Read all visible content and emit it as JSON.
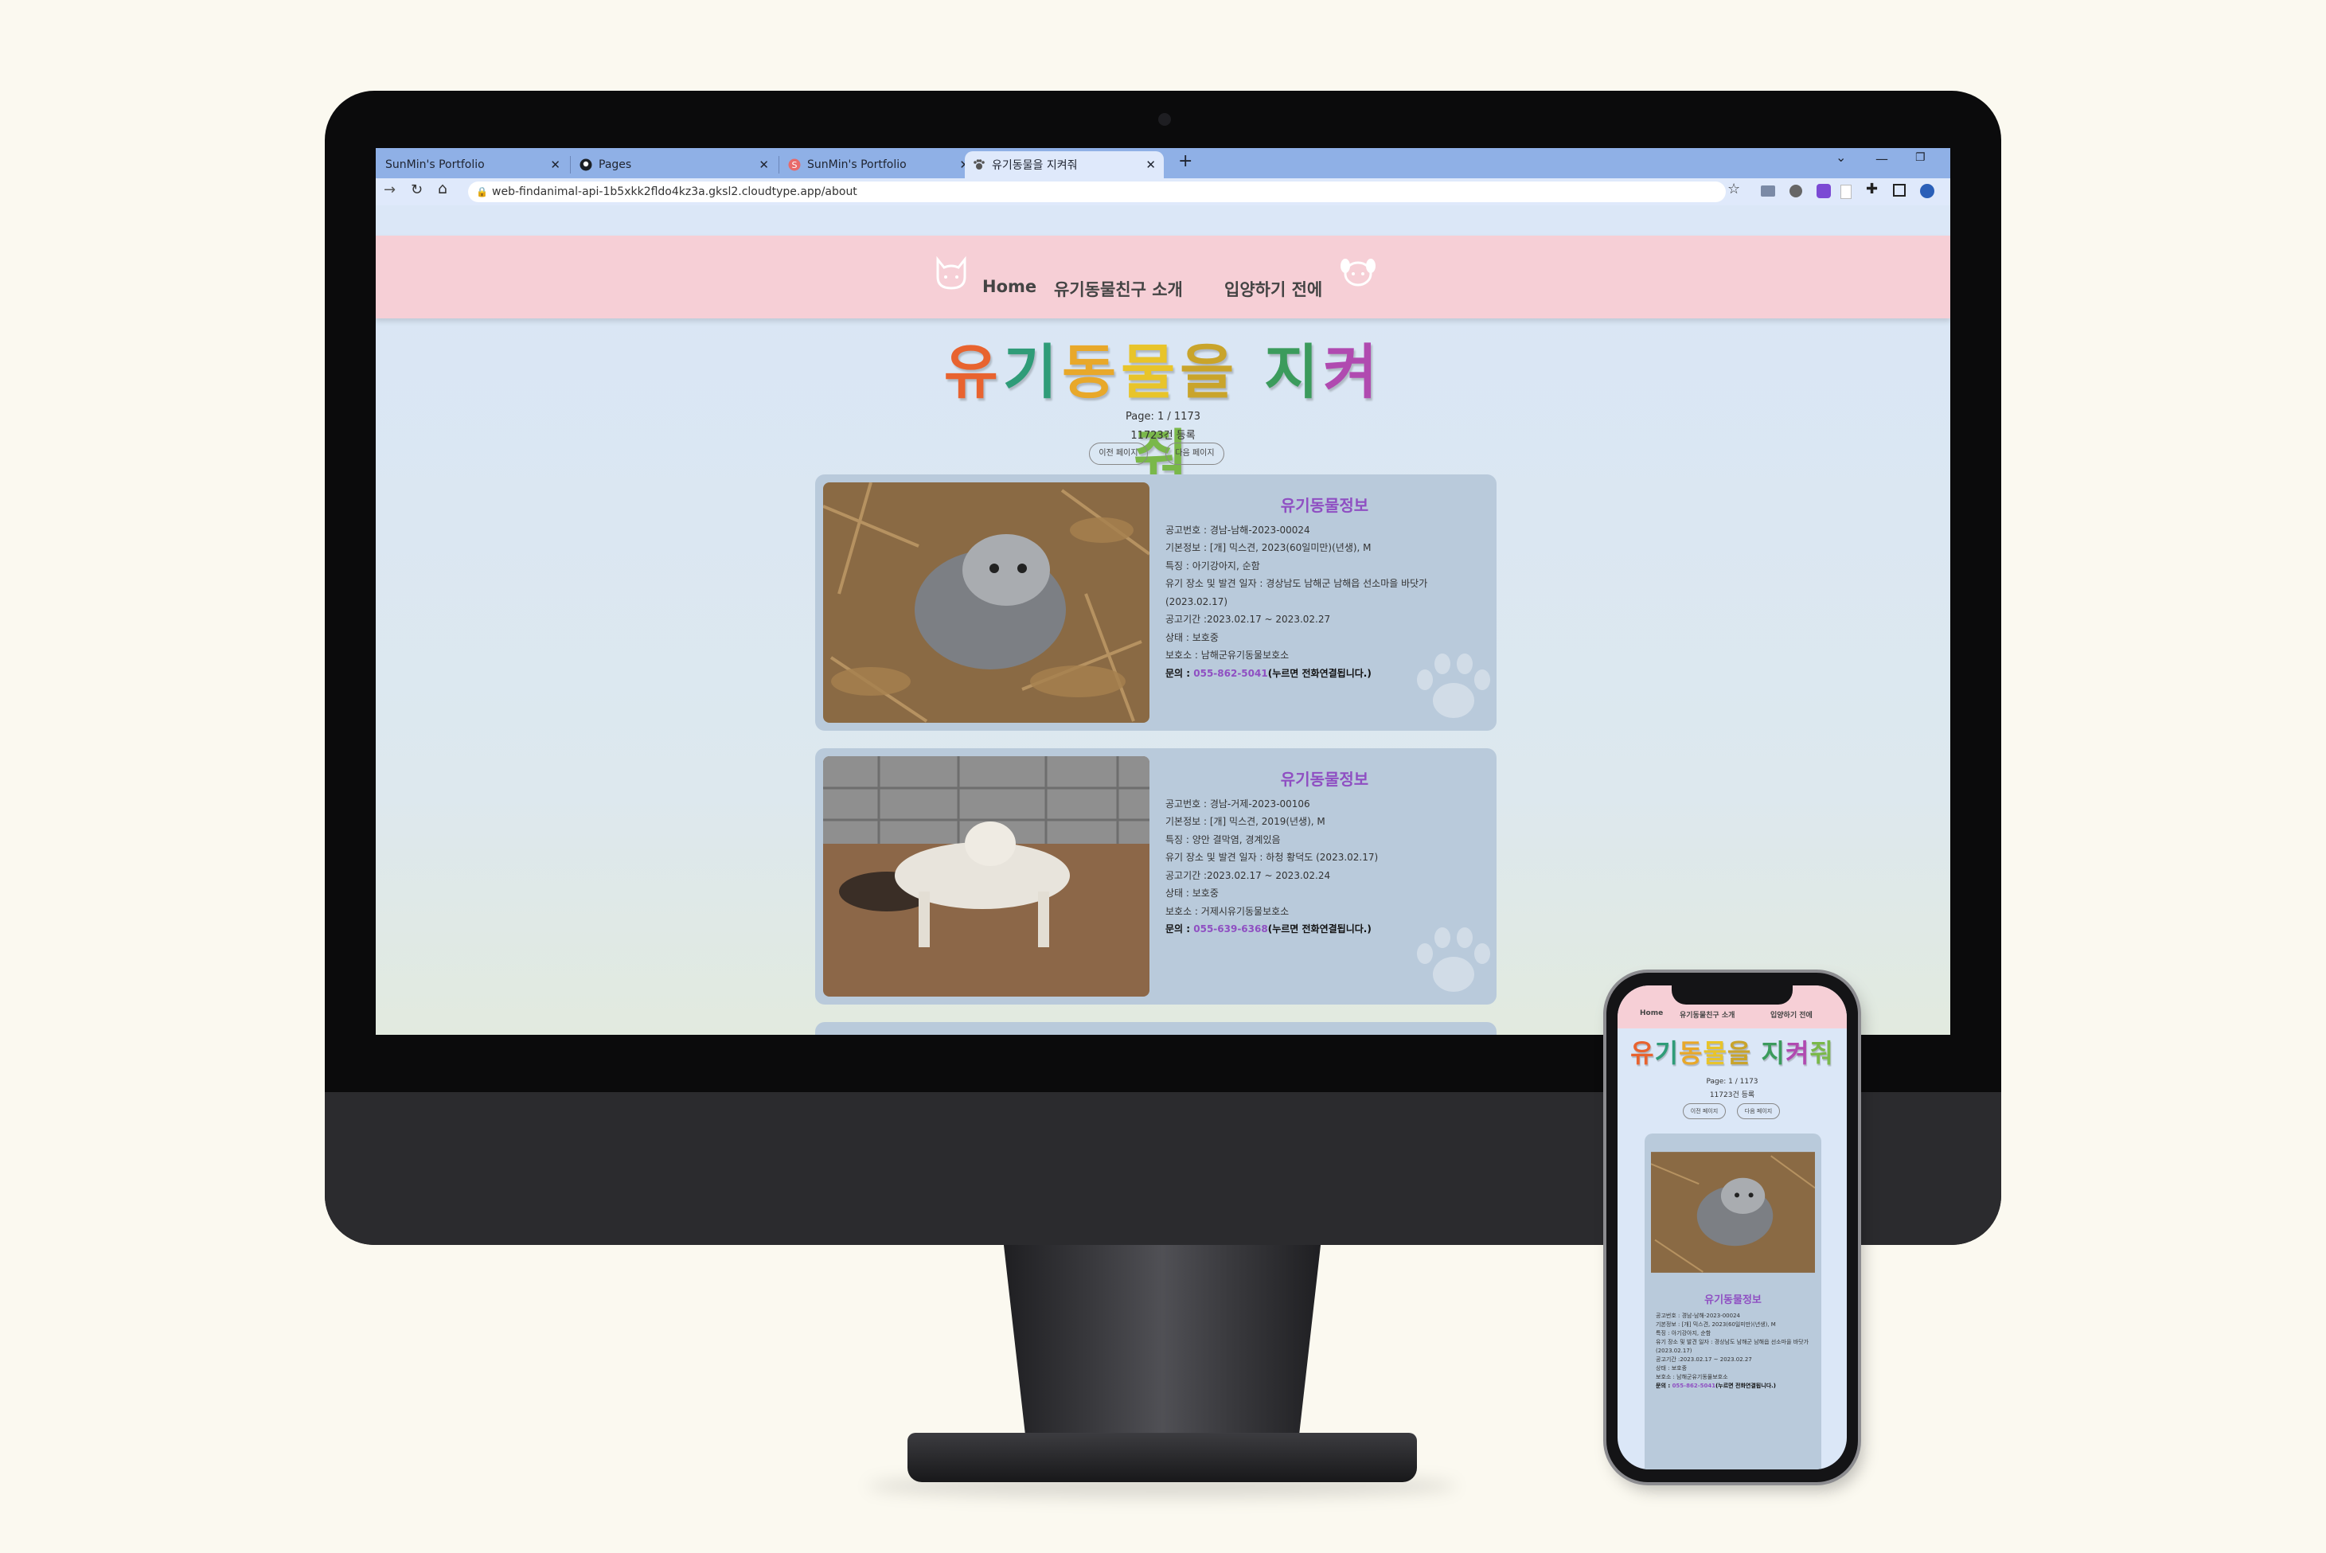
{
  "browser": {
    "tabs": [
      {
        "label": "SunMin's Portfolio",
        "icon": "none"
      },
      {
        "label": "Pages",
        "icon": "github-icon"
      },
      {
        "label": "SunMin's Portfolio",
        "icon": "s-logo-icon"
      },
      {
        "label": "유기동물을 지켜줘",
        "icon": "paw-icon"
      }
    ],
    "url": "web-findanimal-api-1b5xkk2fldo4kz3a.gksl2.cloudtype.app/about"
  },
  "nav": {
    "items": [
      "Home",
      "유기동물친구 소개",
      "입양하기 전에"
    ]
  },
  "header": {
    "title_chars": [
      "유",
      "기",
      "동",
      "물",
      "을",
      " ",
      "지",
      "켜",
      "줘"
    ],
    "title_colors": [
      "#e8632f",
      "#2f9c78",
      "#e8a82a",
      "#e8c42a",
      "#c9a42b",
      "#ffffff",
      "#3b9b5c",
      "#b04ab0",
      "#7ab84a"
    ],
    "page_info": "Page: 1 / 1173",
    "count": "11723건 등록",
    "prev_button": "이전 페이지",
    "next_button": "다음 페이지"
  },
  "cards": [
    {
      "heading": "유기동물정보",
      "notice_no": "공고번호 : 경남-남해-2023-00024",
      "basic": "기본정보 : [개] 믹스견, 2023(60일미만)(년생), M",
      "feature": "특징 : 아기강아지, 순함",
      "found": "유기 장소 및 발견 일자 : 경상남도 남해군 남해읍 선소마을 바닷가(2023.02.17)",
      "period": "공고기간 :2023.02.17 ~ 2023.02.27",
      "status": "상태 : 보호중",
      "shelter": "보호소 : 남해군유기동물보호소",
      "contact_label": "문의 : ",
      "phone": "055-862-5041",
      "contact_note": "(누르면 전화연결됩니다.)"
    },
    {
      "heading": "유기동물정보",
      "notice_no": "공고번호 : 경남-거제-2023-00106",
      "basic": "기본정보 : [개] 믹스견, 2019(년생), M",
      "feature": "특징 : 양안 결막염, 경계있음",
      "found": "유기 장소 및 발견 일자 : 하청 황덕도 (2023.02.17)",
      "period": "공고기간 :2023.02.17 ~ 2023.02.24",
      "status": "상태 : 보호중",
      "shelter": "보호소 : 거제시유기동물보호소",
      "contact_label": "문의 : ",
      "phone": "055-639-6368",
      "contact_note": "(누르면 전화연결됩니다.)"
    }
  ],
  "mobile": {
    "nav": [
      "Home",
      "유기동물친구 소개",
      "입양하기 전에"
    ],
    "page_info": "Page: 1 / 1173",
    "count": "11723건 등록",
    "prev_button": "이전 페이지",
    "next_button": "다음 페이지",
    "card_heading": "유기동물정보",
    "lines": [
      "공고번호 : 경남-남해-2023-00024",
      "기본정보 : [개] 믹스견, 2023(60일미만)(년생), M",
      "특징 : 아기강아지, 순함",
      "유기 장소 및 발견 일자 : 경상남도 남해군 남해읍 선소마을 바닷가(2023.02.17)",
      "공고기간 :2023.02.17 ~ 2023.02.27",
      "상태 : 보호중",
      "보호소 : 남해군유기동물보호소"
    ],
    "contact_label": "문의 : ",
    "phone": "055-862-5041",
    "contact_note": "(누르면 전화연결됩니다.)"
  },
  "colors": {
    "background": "#fbf9f0",
    "navbar": "#f6cfd6",
    "page": "#d9e6f6",
    "card": "#b9cadb",
    "accent": "#8f4fc2",
    "tabbar": "#8fb0e6"
  }
}
